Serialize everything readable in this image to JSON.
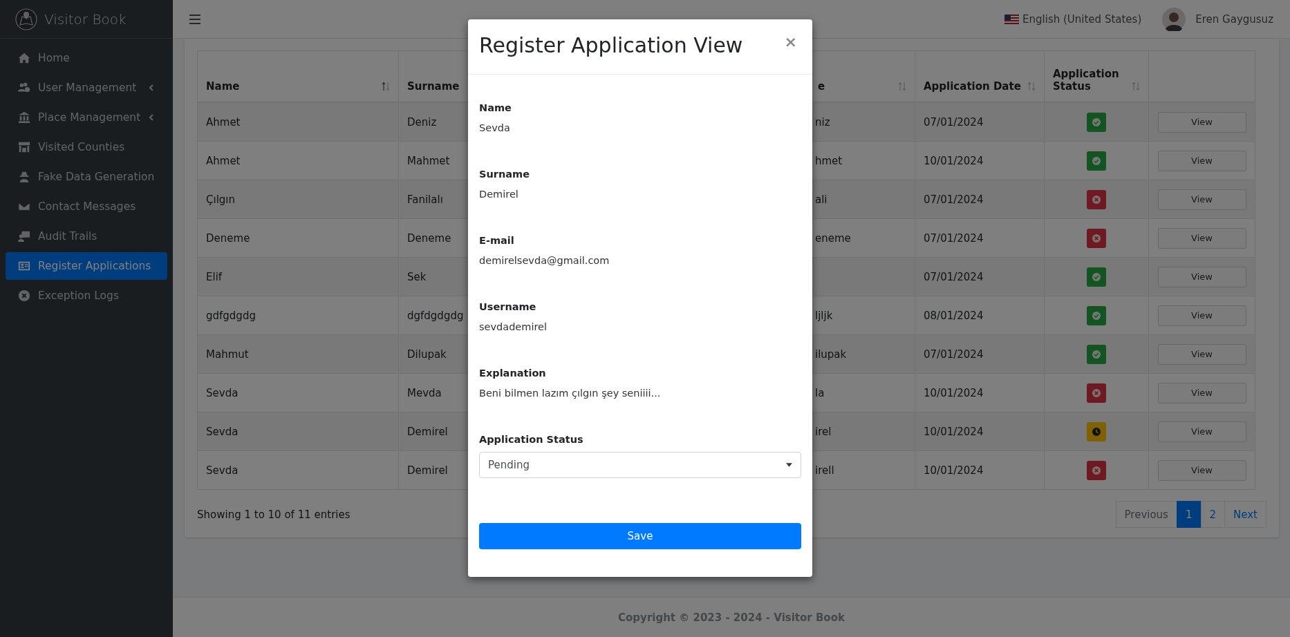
{
  "brand": {
    "title": "Visitor Book"
  },
  "sidebar": {
    "items": [
      {
        "label": "Home",
        "has_submenu": false,
        "selected": false
      },
      {
        "label": "User Management",
        "has_submenu": true,
        "selected": false
      },
      {
        "label": "Place Management",
        "has_submenu": true,
        "selected": false
      },
      {
        "label": "Visited Counties",
        "has_submenu": false,
        "selected": false
      },
      {
        "label": "Fake Data Generation",
        "has_submenu": false,
        "selected": false
      },
      {
        "label": "Contact Messages",
        "has_submenu": false,
        "selected": false
      },
      {
        "label": "Audit Trails",
        "has_submenu": false,
        "selected": false
      },
      {
        "label": "Register Applications",
        "has_submenu": false,
        "selected": true
      },
      {
        "label": "Exception Logs",
        "has_submenu": false,
        "selected": false
      }
    ]
  },
  "topbar": {
    "language": "English (United States)",
    "user": "Eren Gaygusuz"
  },
  "table": {
    "columns": [
      {
        "label": "Name",
        "sortable": true
      },
      {
        "label": "Surname"
      },
      {},
      {
        "label": "e",
        "sortable": true
      },
      {
        "label": "Application Date",
        "sortable": true
      },
      {
        "label": "Application Status",
        "sortable": true
      },
      {
        "sortable": false
      }
    ],
    "rows": [
      {
        "name": "Ahmet",
        "surname": "Deniz",
        "column_4": "niz",
        "date": "07/01/2024",
        "kind": "approved",
        "action": "View"
      },
      {
        "name": "Ahmet",
        "surname": "Mahmet",
        "column_4": "hmet",
        "date": "10/01/2024",
        "kind": "approved",
        "action": "View"
      },
      {
        "name": "Çılgın",
        "surname": "Fanilalı",
        "column_4": "ali",
        "date": "07/01/2024",
        "kind": "rejected",
        "action": "View"
      },
      {
        "name": "Deneme",
        "surname": "Deneme",
        "column_4": "eneme",
        "date": "07/01/2024",
        "kind": "rejected",
        "action": "View"
      },
      {
        "name": "Elif",
        "surname": "Sek",
        "date": "07/01/2024",
        "kind": "approved",
        "action": "View"
      },
      {
        "name": "gdfgdgdg",
        "surname": "dgfdgdgdg",
        "column_4": "ljljk",
        "date": "08/01/2024",
        "kind": "approved",
        "action": "View"
      },
      {
        "name": "Mahmut",
        "surname": "Dilupak",
        "column_4": "ilupak",
        "date": "07/01/2024",
        "kind": "approved",
        "action": "View"
      },
      {
        "name": "Sevda",
        "surname": "Mevda",
        "column_4": "la",
        "date": "10/01/2024",
        "kind": "rejected",
        "action": "View"
      },
      {
        "name": "Sevda",
        "surname": "Demirel",
        "column_4": "irel",
        "date": "10/01/2024",
        "kind": "pending",
        "action": "View"
      },
      {
        "name": "Sevda",
        "surname": "Demirel",
        "column_4": "irell",
        "date": "10/01/2024",
        "kind": "rejected",
        "action": "View"
      }
    ]
  },
  "info": "Showing 1 to 10 of 11 entries",
  "pagination": [
    {
      "label": "Previous",
      "selected": false,
      "disabled": true
    },
    {
      "label": "1",
      "selected": true,
      "disabled": false
    },
    {
      "label": "2",
      "selected": false,
      "disabled": false
    },
    {
      "label": "Next",
      "selected": false,
      "disabled": false
    }
  ],
  "footer": "Copyright © 2023 - 2024 - Visitor Book",
  "modal": {
    "title": "Register Application View",
    "close": "×",
    "fields": [
      {
        "label": "Name",
        "value": "Sevda"
      },
      {
        "label": "Surname",
        "value": "Demirel"
      },
      {
        "label": "E-mail",
        "value": "demirelsevda@gmail.com"
      },
      {
        "label": "Username",
        "value": "sevdademirel"
      },
      {
        "label": "Explanation",
        "value": "Beni bilmen lazım çılgın şey seniiii..."
      }
    ],
    "status_label": "Application Status",
    "status_value": "Pending",
    "save": "Save"
  }
}
